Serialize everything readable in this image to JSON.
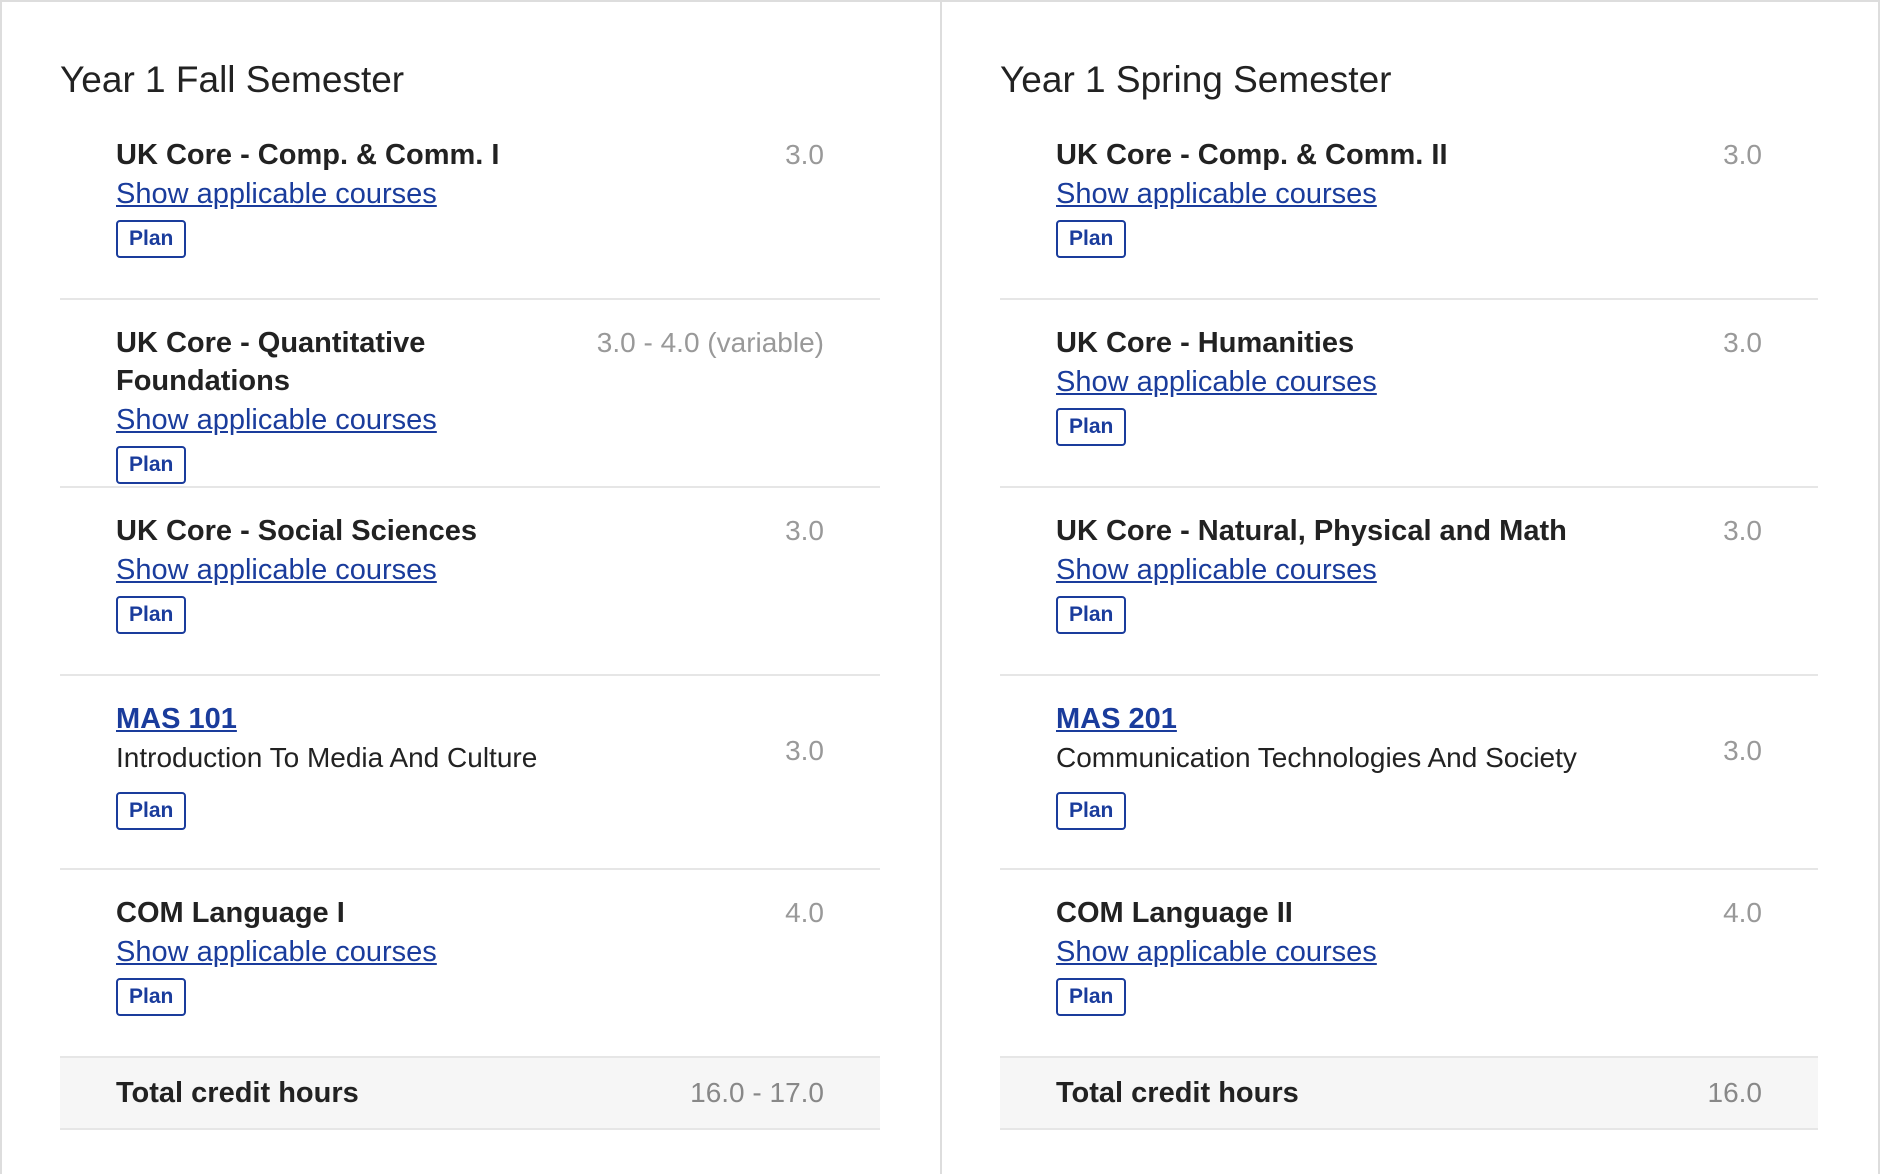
{
  "semesters": [
    {
      "title": "Year 1 Fall Semester",
      "requirements": [
        {
          "name": "UK Core - Comp. & Comm. I",
          "credits": "3.0",
          "link": "Show applicable courses",
          "plan": "Plan"
        },
        {
          "name": "UK Core - Quantitative Foundations",
          "credits": "3.0 - 4.0 (variable)",
          "link": "Show applicable courses",
          "plan": "Plan"
        },
        {
          "name": "UK Core - Social Sciences",
          "credits": "3.0",
          "link": "Show applicable courses",
          "plan": "Plan"
        }
      ],
      "course": {
        "code": "MAS 101",
        "title": "Introduction To Media And Culture",
        "credits": "3.0",
        "plan": "Plan"
      },
      "language": {
        "name": "COM Language I",
        "credits": "4.0",
        "link": "Show applicable courses",
        "plan": "Plan"
      },
      "total": {
        "label": "Total credit hours",
        "value": "16.0 - 17.0"
      }
    },
    {
      "title": "Year 1 Spring Semester",
      "requirements": [
        {
          "name": "UK Core - Comp. & Comm. II",
          "credits": "3.0",
          "link": "Show applicable courses",
          "plan": "Plan"
        },
        {
          "name": "UK Core - Humanities",
          "credits": "3.0",
          "link": "Show applicable courses",
          "plan": "Plan"
        },
        {
          "name": "UK Core - Natural, Physical and Math",
          "credits": "3.0",
          "link": "Show applicable courses",
          "plan": "Plan"
        }
      ],
      "course": {
        "code": "MAS 201",
        "title": "Communication Technologies And Society",
        "credits": "3.0",
        "plan": "Plan"
      },
      "language": {
        "name": "COM Language II",
        "credits": "4.0",
        "link": "Show applicable courses",
        "plan": "Plan"
      },
      "total": {
        "label": "Total credit hours",
        "value": "16.0"
      }
    }
  ],
  "colors": {
    "link": "#1a3c9c",
    "muted": "#999999",
    "text": "#222222"
  }
}
